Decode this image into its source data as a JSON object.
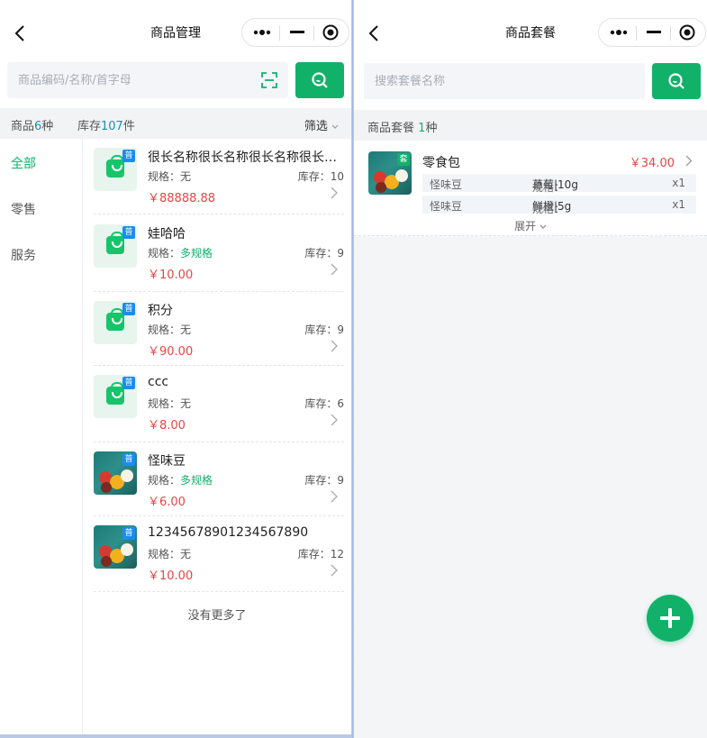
{
  "left": {
    "title": "商品管理",
    "search": {
      "placeholder": "商品编码/名称/首字母"
    },
    "summary": {
      "goods_label": "商品",
      "goods_count": "6",
      "goods_unit": "种",
      "stock_label": "库存",
      "stock_count": "107",
      "stock_unit": "件",
      "filter": "筛选"
    },
    "categories": [
      {
        "label": "全部",
        "active": true
      },
      {
        "label": "零售",
        "active": false
      },
      {
        "label": "服务",
        "active": false
      }
    ],
    "products": [
      {
        "name": "很长名称很长名称很长名称很长名称很长名称",
        "spec_label": "规格：",
        "spec": "无",
        "spec_multi": false,
        "stock_label": "库存：",
        "stock": "10",
        "price": "￥88888.88",
        "thumb": "bag",
        "tag": "普"
      },
      {
        "name": "娃哈哈",
        "spec_label": "规格：",
        "spec": "多规格",
        "spec_multi": true,
        "stock_label": "库存：",
        "stock": "9",
        "price": "￥10.00",
        "thumb": "bag",
        "tag": "普"
      },
      {
        "name": "积分",
        "spec_label": "规格：",
        "spec": "无",
        "spec_multi": false,
        "stock_label": "库存：",
        "stock": "9",
        "price": "￥90.00",
        "thumb": "bag",
        "tag": "普"
      },
      {
        "name": "ccc",
        "spec_label": "规格：",
        "spec": "无",
        "spec_multi": false,
        "stock_label": "库存：",
        "stock": "6",
        "price": "￥8.00",
        "thumb": "bag",
        "tag": "普"
      },
      {
        "name": "怪味豆",
        "spec_label": "规格：",
        "spec": "多规格",
        "spec_multi": true,
        "stock_label": "库存：",
        "stock": "9",
        "price": "￥6.00",
        "thumb": "pool",
        "tag": "普"
      },
      {
        "name": "12345678901234567890",
        "spec_label": "规格：",
        "spec": "无",
        "spec_multi": false,
        "stock_label": "库存：",
        "stock": "12",
        "price": "￥10.00",
        "thumb": "pool",
        "tag": "普"
      }
    ],
    "no_more": "没有更多了"
  },
  "right": {
    "title": "商品套餐",
    "search": {
      "placeholder": "搜索套餐名称"
    },
    "summary": {
      "label": "商品套餐",
      "count": "1",
      "unit": "种"
    },
    "package": {
      "name": "零食包",
      "price": "￥34.00",
      "tag": "套",
      "items": [
        {
          "name": "怪味豆",
          "spec_label": "规格：",
          "spec": "草莓|10g",
          "qty": "x1"
        },
        {
          "name": "怪味豆",
          "spec_label": "规格：",
          "spec": "鲜橙|5g",
          "qty": "x1"
        }
      ],
      "expand": "展开"
    }
  },
  "colors": {
    "accent": "#12b16a",
    "price": "#e64545",
    "count": "#1a8fb0",
    "tag_blue": "#1a8df0"
  },
  "icons": [
    "back-icon",
    "more-dots-icon",
    "minimize-icon",
    "target-icon",
    "scan-icon",
    "search-icon",
    "chevron-right-icon",
    "chevron-down-icon",
    "plus-icon"
  ]
}
